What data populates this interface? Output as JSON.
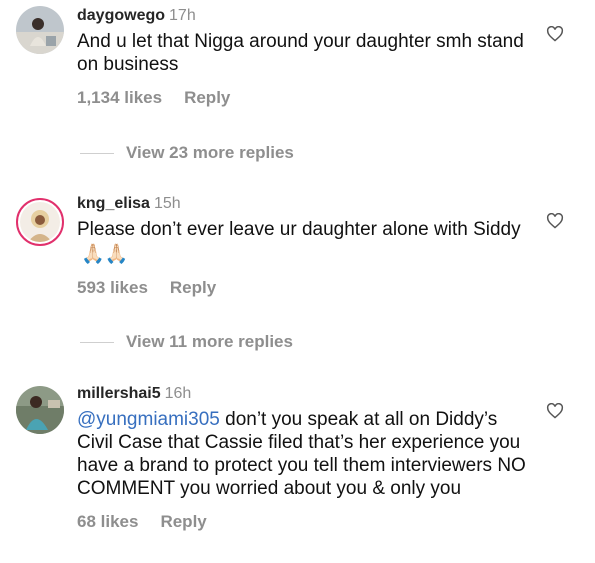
{
  "comments": [
    {
      "username": "daygowego",
      "time": "17h",
      "text": "And u let that Nigga around your daughter smh stand on business",
      "likes": "1,134 likes",
      "reply": "Reply",
      "view_replies": "View 23 more replies",
      "avatar_icon": "avatar-photo-icon",
      "heart_icon": "heart-outline-icon"
    },
    {
      "username": "kng_elisa",
      "time": "15h",
      "text": "Please don’t ever leave ur daughter alone with Siddy",
      "emoji": "🙏🏻🙏🏻",
      "likes": "593 likes",
      "reply": "Reply",
      "view_replies": "View 11 more replies",
      "avatar_icon": "avatar-photo-icon",
      "heart_icon": "heart-outline-icon"
    },
    {
      "username": "millershai5",
      "time": "16h",
      "mention": "@yungmiami305",
      "text": " don’t you speak at all on Diddy’s Civil Case that Cassie filed that’s her experience you have a brand to protect you tell them interviewers NO COMMENT you worried about you & only you",
      "likes": "68 likes",
      "reply": "Reply",
      "avatar_icon": "avatar-photo-icon",
      "heart_icon": "heart-outline-icon"
    }
  ],
  "colors": {
    "mention": "#376fbf",
    "secondary_text": "#8e8e8e",
    "story_ring": "#e1306c"
  }
}
